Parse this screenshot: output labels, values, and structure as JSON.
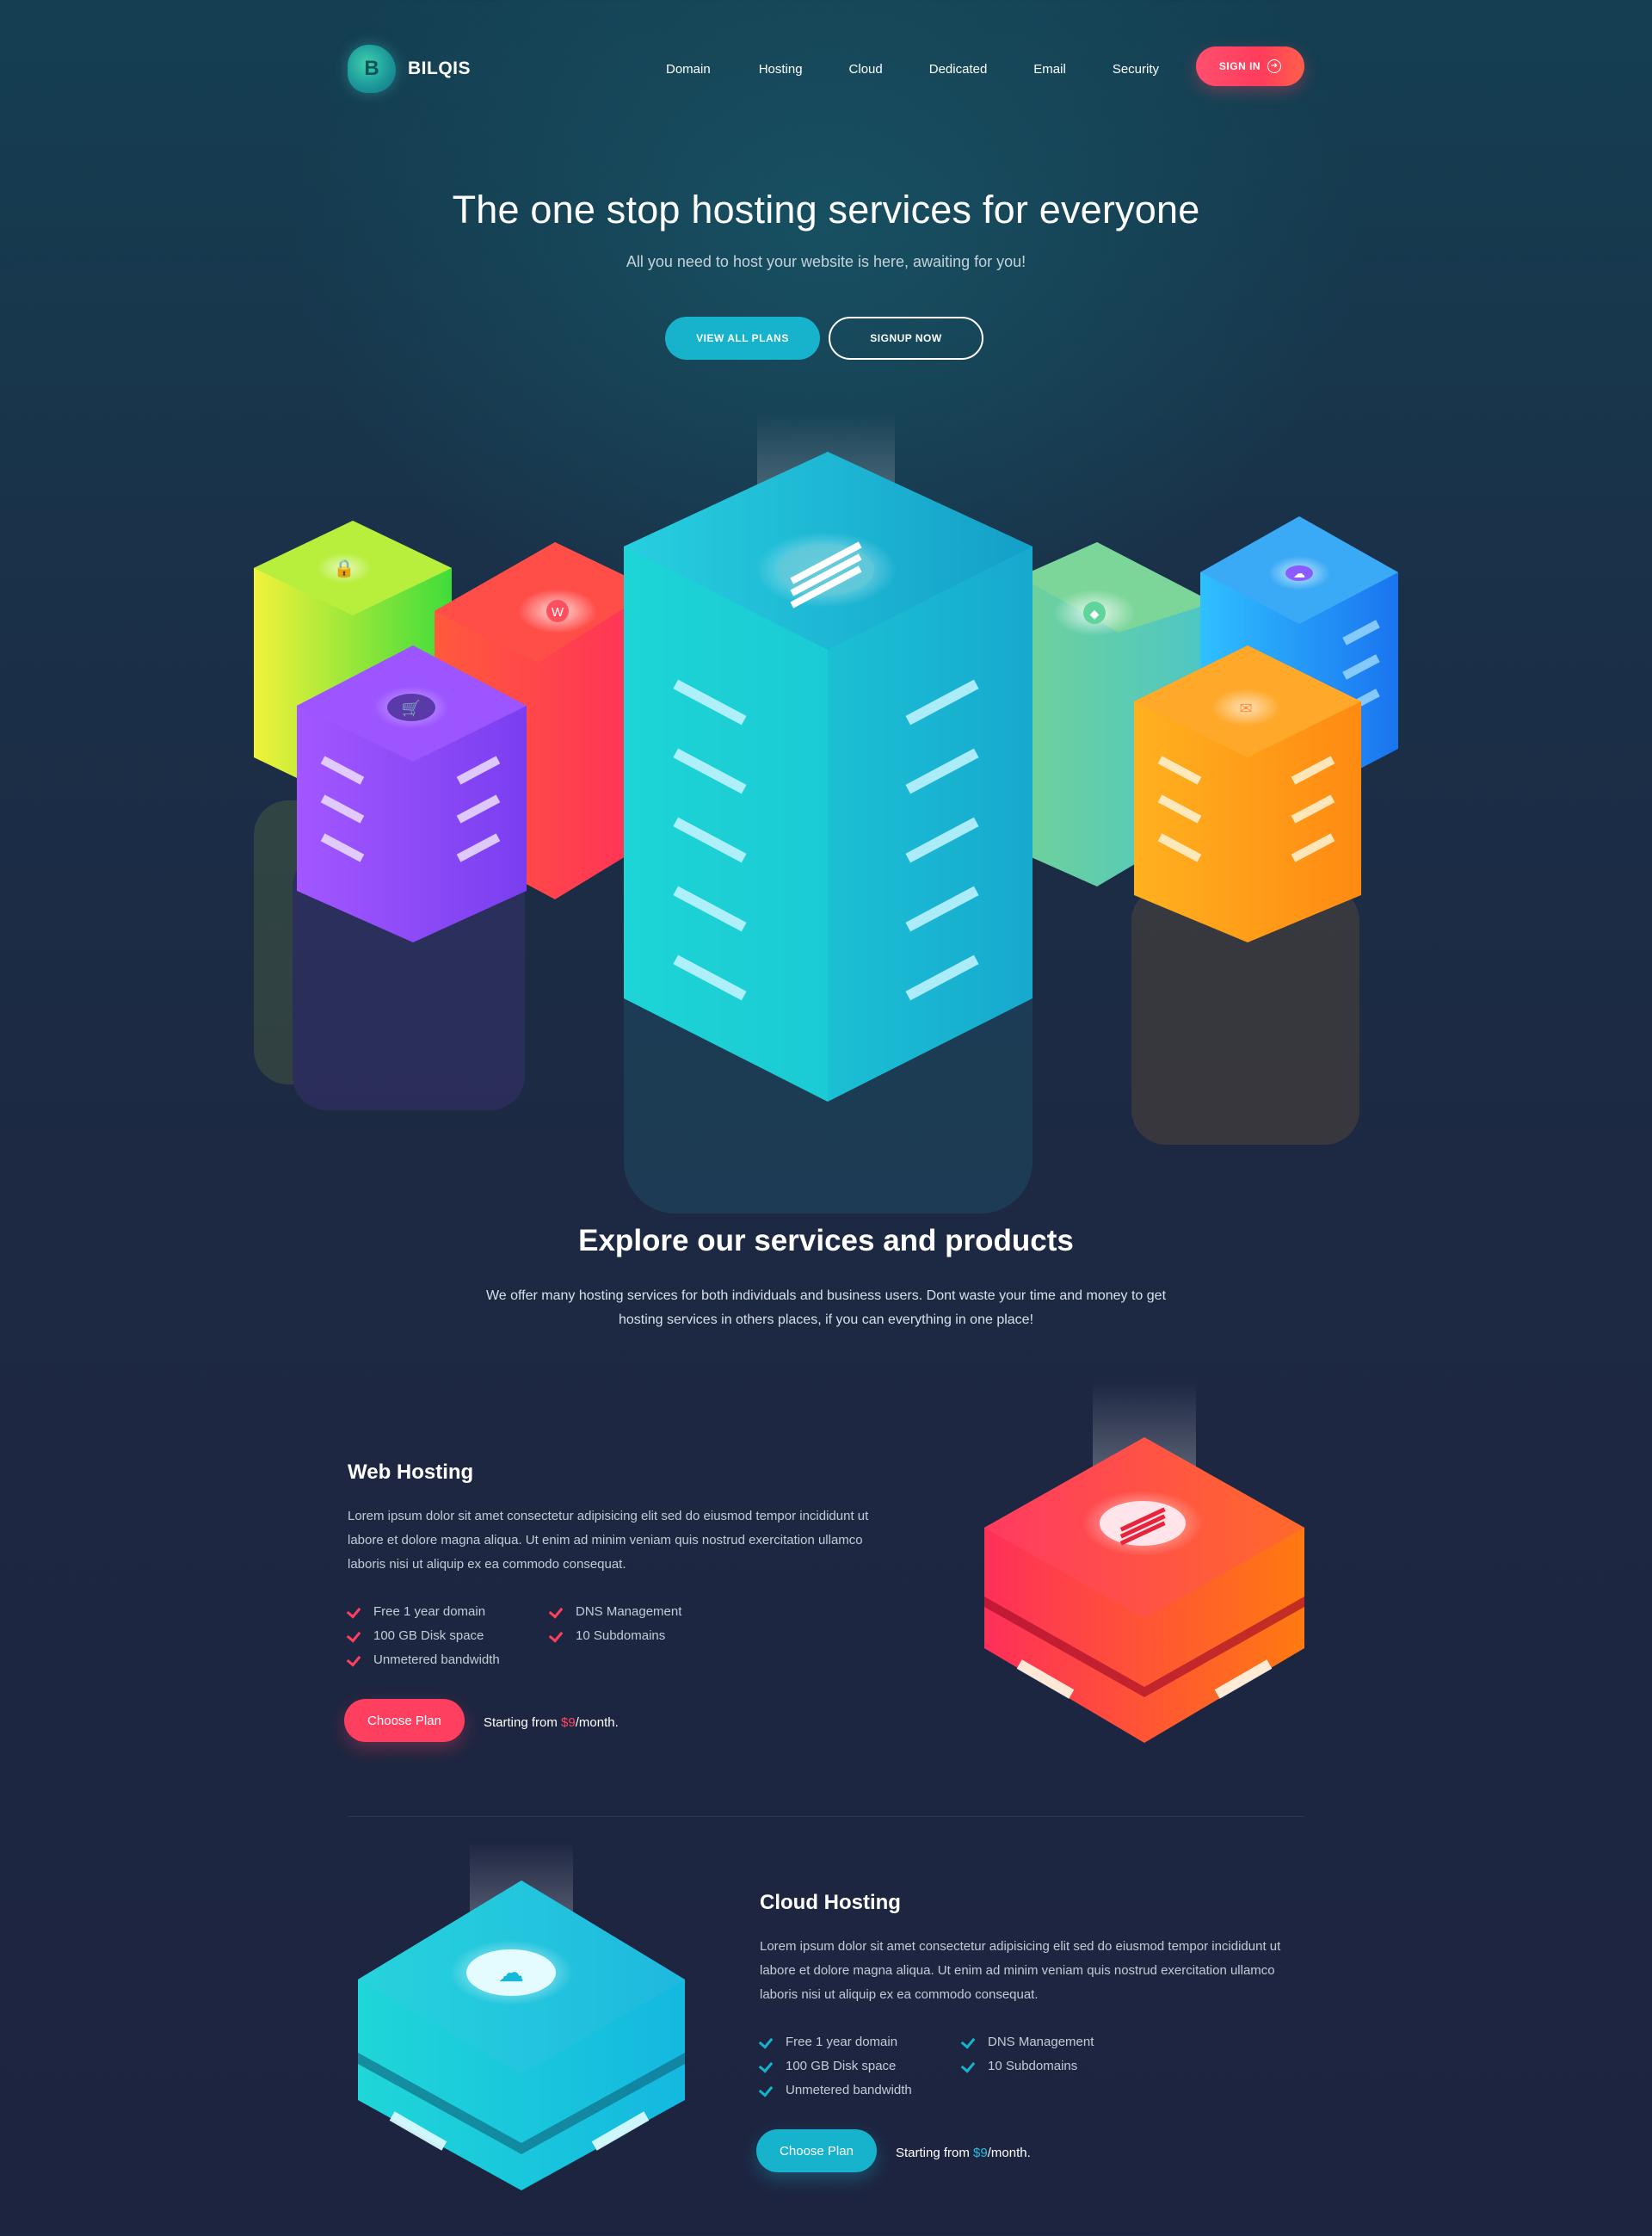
{
  "brand": {
    "logo_letter": "B",
    "name": "BILQIS"
  },
  "nav": {
    "items": [
      "Domain",
      "Hosting",
      "Cloud",
      "Dedicated",
      "Email",
      "Security"
    ],
    "signin_label": "SIGN IN",
    "signin_icon": "arrow-right-circle-icon"
  },
  "hero": {
    "title": "The one stop hosting services for everyone",
    "subtitle": "All you need to host your website is here, awaiting for you!",
    "primary_button": "VIEW ALL PLANS",
    "secondary_button": "SIGNUP NOW"
  },
  "explore": {
    "title": "Explore our services and products",
    "text": "We offer many hosting services for both individuals and business users. Dont waste your time and money to get hosting services in others places, if you can everything in one place!"
  },
  "products": [
    {
      "title": "Web Hosting",
      "text": "Lorem ipsum dolor sit amet consectetur adipisicing elit sed do eiusmod tempor incididunt ut labore et dolore magna aliqua. Ut enim ad minim veniam quis nostrud exercitation ullamco laboris nisi ut aliquip ex ea commodo consequat.",
      "features": [
        "Free 1 year domain",
        "DNS Management",
        "100 GB Disk space",
        "10 Subdomains",
        "Unmetered bandwidth"
      ],
      "button": "Choose Plan",
      "price_prefix": "Starting from ",
      "price": "$9",
      "price_suffix": "/month.",
      "accent": "#ff3f5f"
    },
    {
      "title": "Cloud Hosting",
      "text": "Lorem ipsum dolor sit amet consectetur adipisicing elit sed do eiusmod tempor incididunt ut labore et dolore magna aliqua. Ut enim ad minim veniam quis nostrud exercitation ullamco laboris nisi ut aliquip ex ea commodo consequat.",
      "features": [
        "Free 1 year domain",
        "DNS Management",
        "100 GB Disk space",
        "10 Subdomains",
        "Unmetered bandwidth"
      ],
      "button": "Choose Plan",
      "price_prefix": "Starting from ",
      "price": "$9",
      "price_suffix": "/month.",
      "accent": "#17b2cc"
    }
  ],
  "colors": {
    "accent_red": "#ff3f5f",
    "accent_cyan": "#17b2cc",
    "bg_dark": "#1d2842"
  },
  "illustration_icons": [
    "lock-icon",
    "wordpress-icon",
    "server-icon",
    "shield-icon",
    "cloud-icon",
    "basket-icon",
    "email-icon"
  ]
}
